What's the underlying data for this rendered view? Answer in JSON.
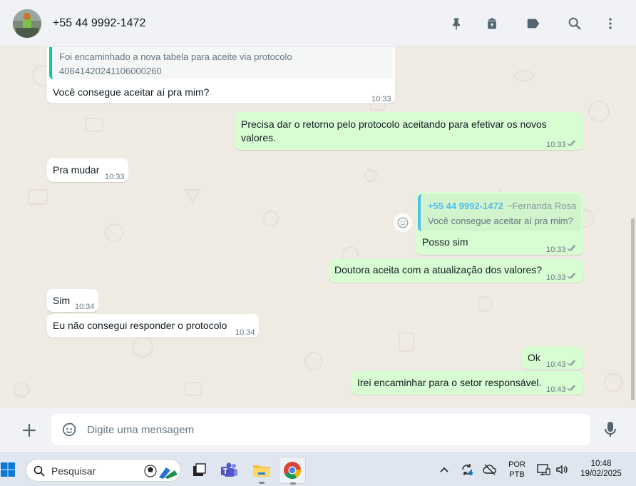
{
  "header": {
    "contact_name": "+55 44 9992-1472",
    "icons": [
      "pin-icon",
      "archive-icon",
      "label-icon",
      "search-icon",
      "menu-icon"
    ]
  },
  "messages": {
    "m1": {
      "quote_text_line1": "Foi encaminhado a nova tabela para aceite via protocolo",
      "quote_text_line2": "40641420241106000260",
      "text": "Você consegue aceitar aí pra mim?",
      "time": "10:33"
    },
    "m2": {
      "text_line1": "Precisa dar o retorno pelo protocolo aceitando para efetivar os novos",
      "text_line2": "valores.",
      "time": "10:33"
    },
    "m3": {
      "text": "Pra mudar",
      "time": "10:33"
    },
    "m4": {
      "quote_author": "+55 44 9992-1472",
      "quote_author_name": "~Fernanda Rosa",
      "quote_text": "Você consegue aceitar aí pra mim?",
      "text": "Posso sim",
      "time": "10:33"
    },
    "m5": {
      "text": "Doutora aceita com a atualização dos valores?",
      "time": "10:33"
    },
    "m6": {
      "text": "Sim",
      "time": "10:34"
    },
    "m7": {
      "text": "Eu não consegui responder o protocolo",
      "time": "10:34"
    },
    "m8": {
      "text": "Ok",
      "time": "10:43"
    },
    "m9": {
      "text": "Irei encaminhar para o setor responsável.",
      "time": "10:43"
    }
  },
  "composer": {
    "placeholder": "Digite uma mensagem"
  },
  "taskbar": {
    "search_label": "Pesquisar",
    "lang_line1": "POR",
    "lang_line2": "PTB",
    "clock_time": "10:48",
    "clock_date": "19/02/2025"
  },
  "colors": {
    "incoming_bubble": "#ffffff",
    "outgoing_bubble": "#d9fdd3",
    "chat_background": "#efeae2",
    "quote_accent_in": "#06cf9c",
    "quote_accent_out": "#53bdeb"
  }
}
